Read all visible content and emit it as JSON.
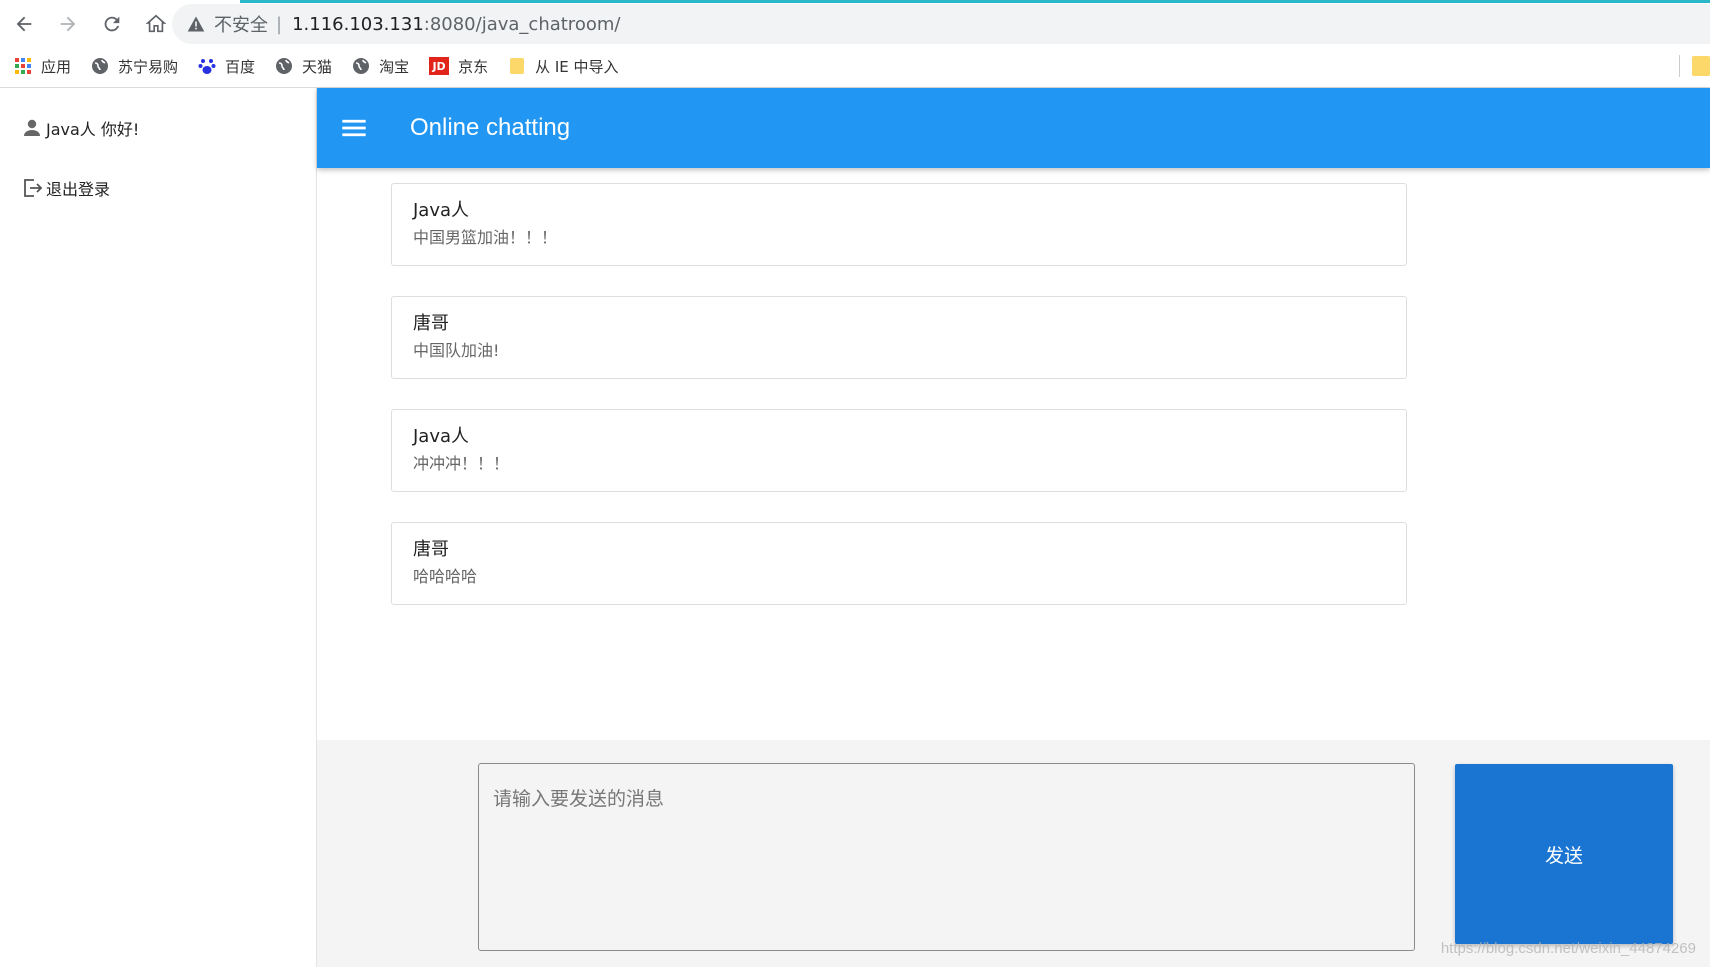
{
  "browser": {
    "address": {
      "security_label": "不安全",
      "separator": "|",
      "host": "1.116.103.131",
      "path": ":8080/java_chatroom/"
    },
    "bookmarks": [
      {
        "label": "应用",
        "icon": "apps-grid-icon"
      },
      {
        "label": "苏宁易购",
        "icon": "globe-icon"
      },
      {
        "label": "百度",
        "icon": "baidu-paw-icon"
      },
      {
        "label": "天猫",
        "icon": "globe-icon"
      },
      {
        "label": "淘宝",
        "icon": "globe-icon"
      },
      {
        "label": "京东",
        "icon": "jd-logo-icon"
      },
      {
        "label": "从 IE 中导入",
        "icon": "folder-icon"
      }
    ],
    "jd_logo_text": "JD"
  },
  "sidebar": {
    "greeting": "Java人 你好!",
    "logout": "退出登录"
  },
  "appbar": {
    "title": "Online chatting",
    "color": "#2196f3"
  },
  "messages": [
    {
      "user": "Java人",
      "text": "中国男篮加油！！！"
    },
    {
      "user": "唐哥",
      "text": "中国队加油!"
    },
    {
      "user": "Java人",
      "text": "冲冲冲！！！"
    },
    {
      "user": "唐哥",
      "text": "哈哈哈哈"
    }
  ],
  "composer": {
    "placeholder": "请输入要发送的消息",
    "send_label": "发送",
    "send_color": "#1a75d2"
  },
  "watermark": "https://blog.csdn.net/weixin_44874269"
}
